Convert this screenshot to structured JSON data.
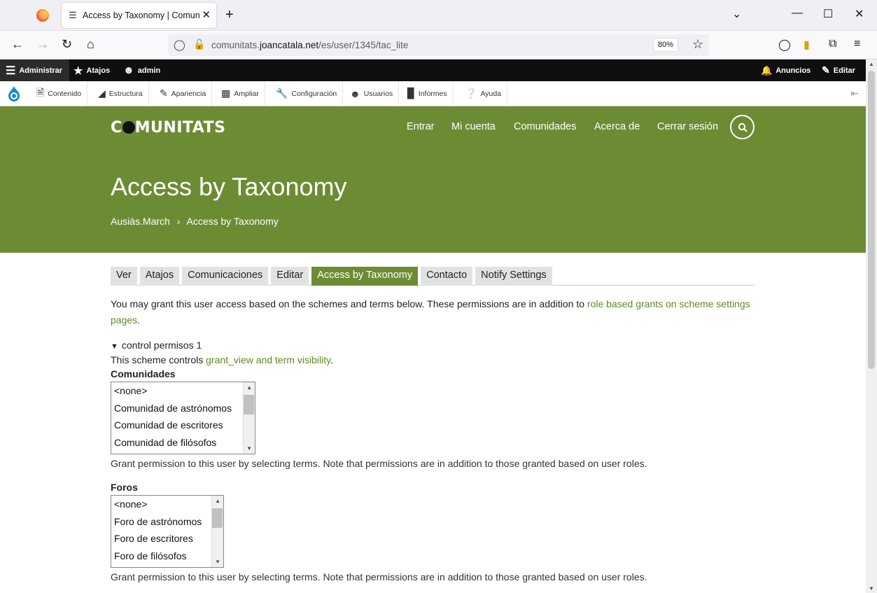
{
  "browser": {
    "tab_title": "Access by Taxonomy | Comunitats",
    "url_prefix": "comunitats.",
    "url_domain": "joancatala.net",
    "url_path": "/es/user/1345/tac_lite",
    "zoom": "80%"
  },
  "admin_toolbar": {
    "manage": "Administrar",
    "shortcuts": "Atajos",
    "user": "admin",
    "announcements": "Anuncios",
    "edit": "Editar"
  },
  "admin_menu": {
    "items": [
      "Contenido",
      "Estructura",
      "Apariencia",
      "Ampliar",
      "Configuración",
      "Usuarios",
      "Informes",
      "Ayuda"
    ]
  },
  "site": {
    "logo_pre": "C",
    "logo_post": "MUNITATS",
    "nav": [
      "Entrar",
      "Mi cuenta",
      "Comunidades",
      "Acerca de",
      "Cerrar sesión"
    ],
    "page_title": "Access by Taxonomy",
    "breadcrumb": [
      "Ausiàs.March",
      "Access by Taxonomy"
    ],
    "breadcrumb_sep": "›"
  },
  "tabs": [
    "Ver",
    "Atajos",
    "Comunicaciones",
    "Editar",
    "Access by Taxonomy",
    "Contacto",
    "Notify Settings"
  ],
  "active_tab": "Access by Taxonomy",
  "intro": {
    "text": "You may grant this user access based on the schemes and terms below. These permissions are in addition to ",
    "link": "role based grants on scheme settings pages",
    "end": "."
  },
  "scheme": {
    "title": "control permisos 1",
    "desc_pre": "This scheme controls ",
    "desc_link": "grant_view and term visibility",
    "desc_end": "."
  },
  "vocab_comunidades": {
    "label": "Comunidades",
    "options": [
      "<none>",
      "Comunidad de astrónomos",
      "Comunidad de escritores",
      "Comunidad de filósofos"
    ],
    "help": "Grant permission to this user by selecting terms. Note that permissions are in addition to those granted based on user roles."
  },
  "vocab_foros": {
    "label": "Foros",
    "options": [
      "<none>",
      "Foro de astrónomos",
      "Foro de escritores",
      "Foro de filósofos"
    ],
    "help": "Grant permission to this user by selecting terms. Note that permissions are in addition to those granted based on user roles."
  }
}
